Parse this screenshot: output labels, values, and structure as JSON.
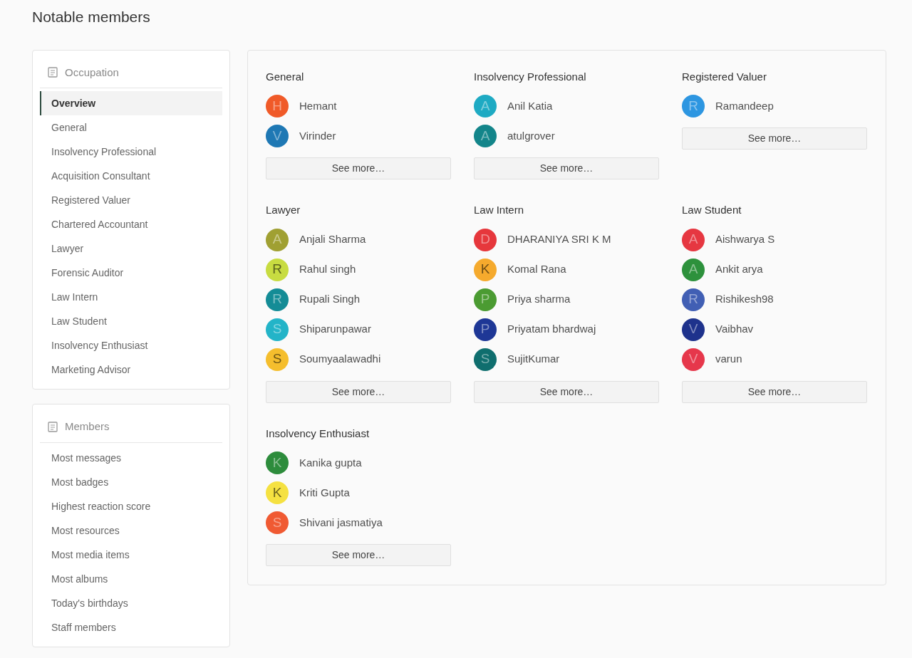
{
  "title": "Notable members",
  "sidebar": [
    {
      "heading": "Occupation",
      "items": [
        {
          "label": "Overview",
          "selected": true
        },
        {
          "label": "General",
          "selected": false
        },
        {
          "label": "Insolvency Professional",
          "selected": false
        },
        {
          "label": "Acquisition Consultant",
          "selected": false
        },
        {
          "label": "Registered Valuer",
          "selected": false
        },
        {
          "label": "Chartered Accountant",
          "selected": false
        },
        {
          "label": "Lawyer",
          "selected": false
        },
        {
          "label": "Forensic Auditor",
          "selected": false
        },
        {
          "label": "Law Intern",
          "selected": false
        },
        {
          "label": "Law Student",
          "selected": false
        },
        {
          "label": "Insolvency Enthusiast",
          "selected": false
        },
        {
          "label": "Marketing Advisor",
          "selected": false
        }
      ]
    },
    {
      "heading": "Members",
      "items": [
        {
          "label": "Most messages",
          "selected": false
        },
        {
          "label": "Most badges",
          "selected": false
        },
        {
          "label": "Highest reaction score",
          "selected": false
        },
        {
          "label": "Most resources",
          "selected": false
        },
        {
          "label": "Most media items",
          "selected": false
        },
        {
          "label": "Most albums",
          "selected": false
        },
        {
          "label": "Today's birthdays",
          "selected": false
        },
        {
          "label": "Staff members",
          "selected": false
        }
      ]
    }
  ],
  "groups": [
    {
      "title": "General",
      "button": "See more…",
      "members": [
        {
          "initial": "H",
          "name": "Hemant",
          "color": "#f05a28"
        },
        {
          "initial": "V",
          "name": "Virinder",
          "color": "#1e78b4"
        }
      ]
    },
    {
      "title": "Insolvency Professional",
      "button": "See more…",
      "members": [
        {
          "initial": "A",
          "name": "Anil Katia",
          "color": "#1eaac3"
        },
        {
          "initial": "A",
          "name": "atulgrover",
          "color": "#13858a"
        }
      ]
    },
    {
      "title": "Registered Valuer",
      "button": "See more…",
      "members": [
        {
          "initial": "R",
          "name": "Ramandeep",
          "color": "#2d96e1"
        }
      ]
    },
    {
      "title": "Lawyer",
      "button": "See more…",
      "members": [
        {
          "initial": "A",
          "name": "Anjali Sharma",
          "color": "#a0a032"
        },
        {
          "initial": "R",
          "name": "Rahul singh",
          "color": "#c8dc41"
        },
        {
          "initial": "R",
          "name": "Rupali Singh",
          "color": "#148c96"
        },
        {
          "initial": "S",
          "name": "Shiparunpawar",
          "color": "#23b4c8"
        },
        {
          "initial": "S",
          "name": "Soumyaalawadhi",
          "color": "#f5be2d"
        }
      ]
    },
    {
      "title": "Law Intern",
      "button": "See more…",
      "members": [
        {
          "initial": "D",
          "name": "DHARANIYA SRI K M",
          "color": "#e6373c"
        },
        {
          "initial": "K",
          "name": "Komal Rana",
          "color": "#f5aa2d"
        },
        {
          "initial": "P",
          "name": "Priya sharma",
          "color": "#4b9b32"
        },
        {
          "initial": "P",
          "name": "Priyatam bhardwaj",
          "color": "#1e3796"
        },
        {
          "initial": "S",
          "name": "SujitKumar",
          "color": "#0f6e6e"
        }
      ]
    },
    {
      "title": "Law Student",
      "button": "See more…",
      "members": [
        {
          "initial": "A",
          "name": "Aishwarya S",
          "color": "#e63741"
        },
        {
          "initial": "A",
          "name": "Ankit arya",
          "color": "#2d913c"
        },
        {
          "initial": "R",
          "name": "Rishikesh98",
          "color": "#415fb4"
        },
        {
          "initial": "V",
          "name": "Vaibhav",
          "color": "#1e328c"
        },
        {
          "initial": "V",
          "name": "varun",
          "color": "#e6374b"
        }
      ]
    },
    {
      "title": "Insolvency Enthusiast",
      "button": "See more…",
      "members": [
        {
          "initial": "K",
          "name": "Kanika gupta",
          "color": "#2d8c3c"
        },
        {
          "initial": "K",
          "name": "Kriti Gupta",
          "color": "#f5e141"
        },
        {
          "initial": "S",
          "name": "Shivani jasmatiya",
          "color": "#f05a32"
        }
      ]
    }
  ]
}
